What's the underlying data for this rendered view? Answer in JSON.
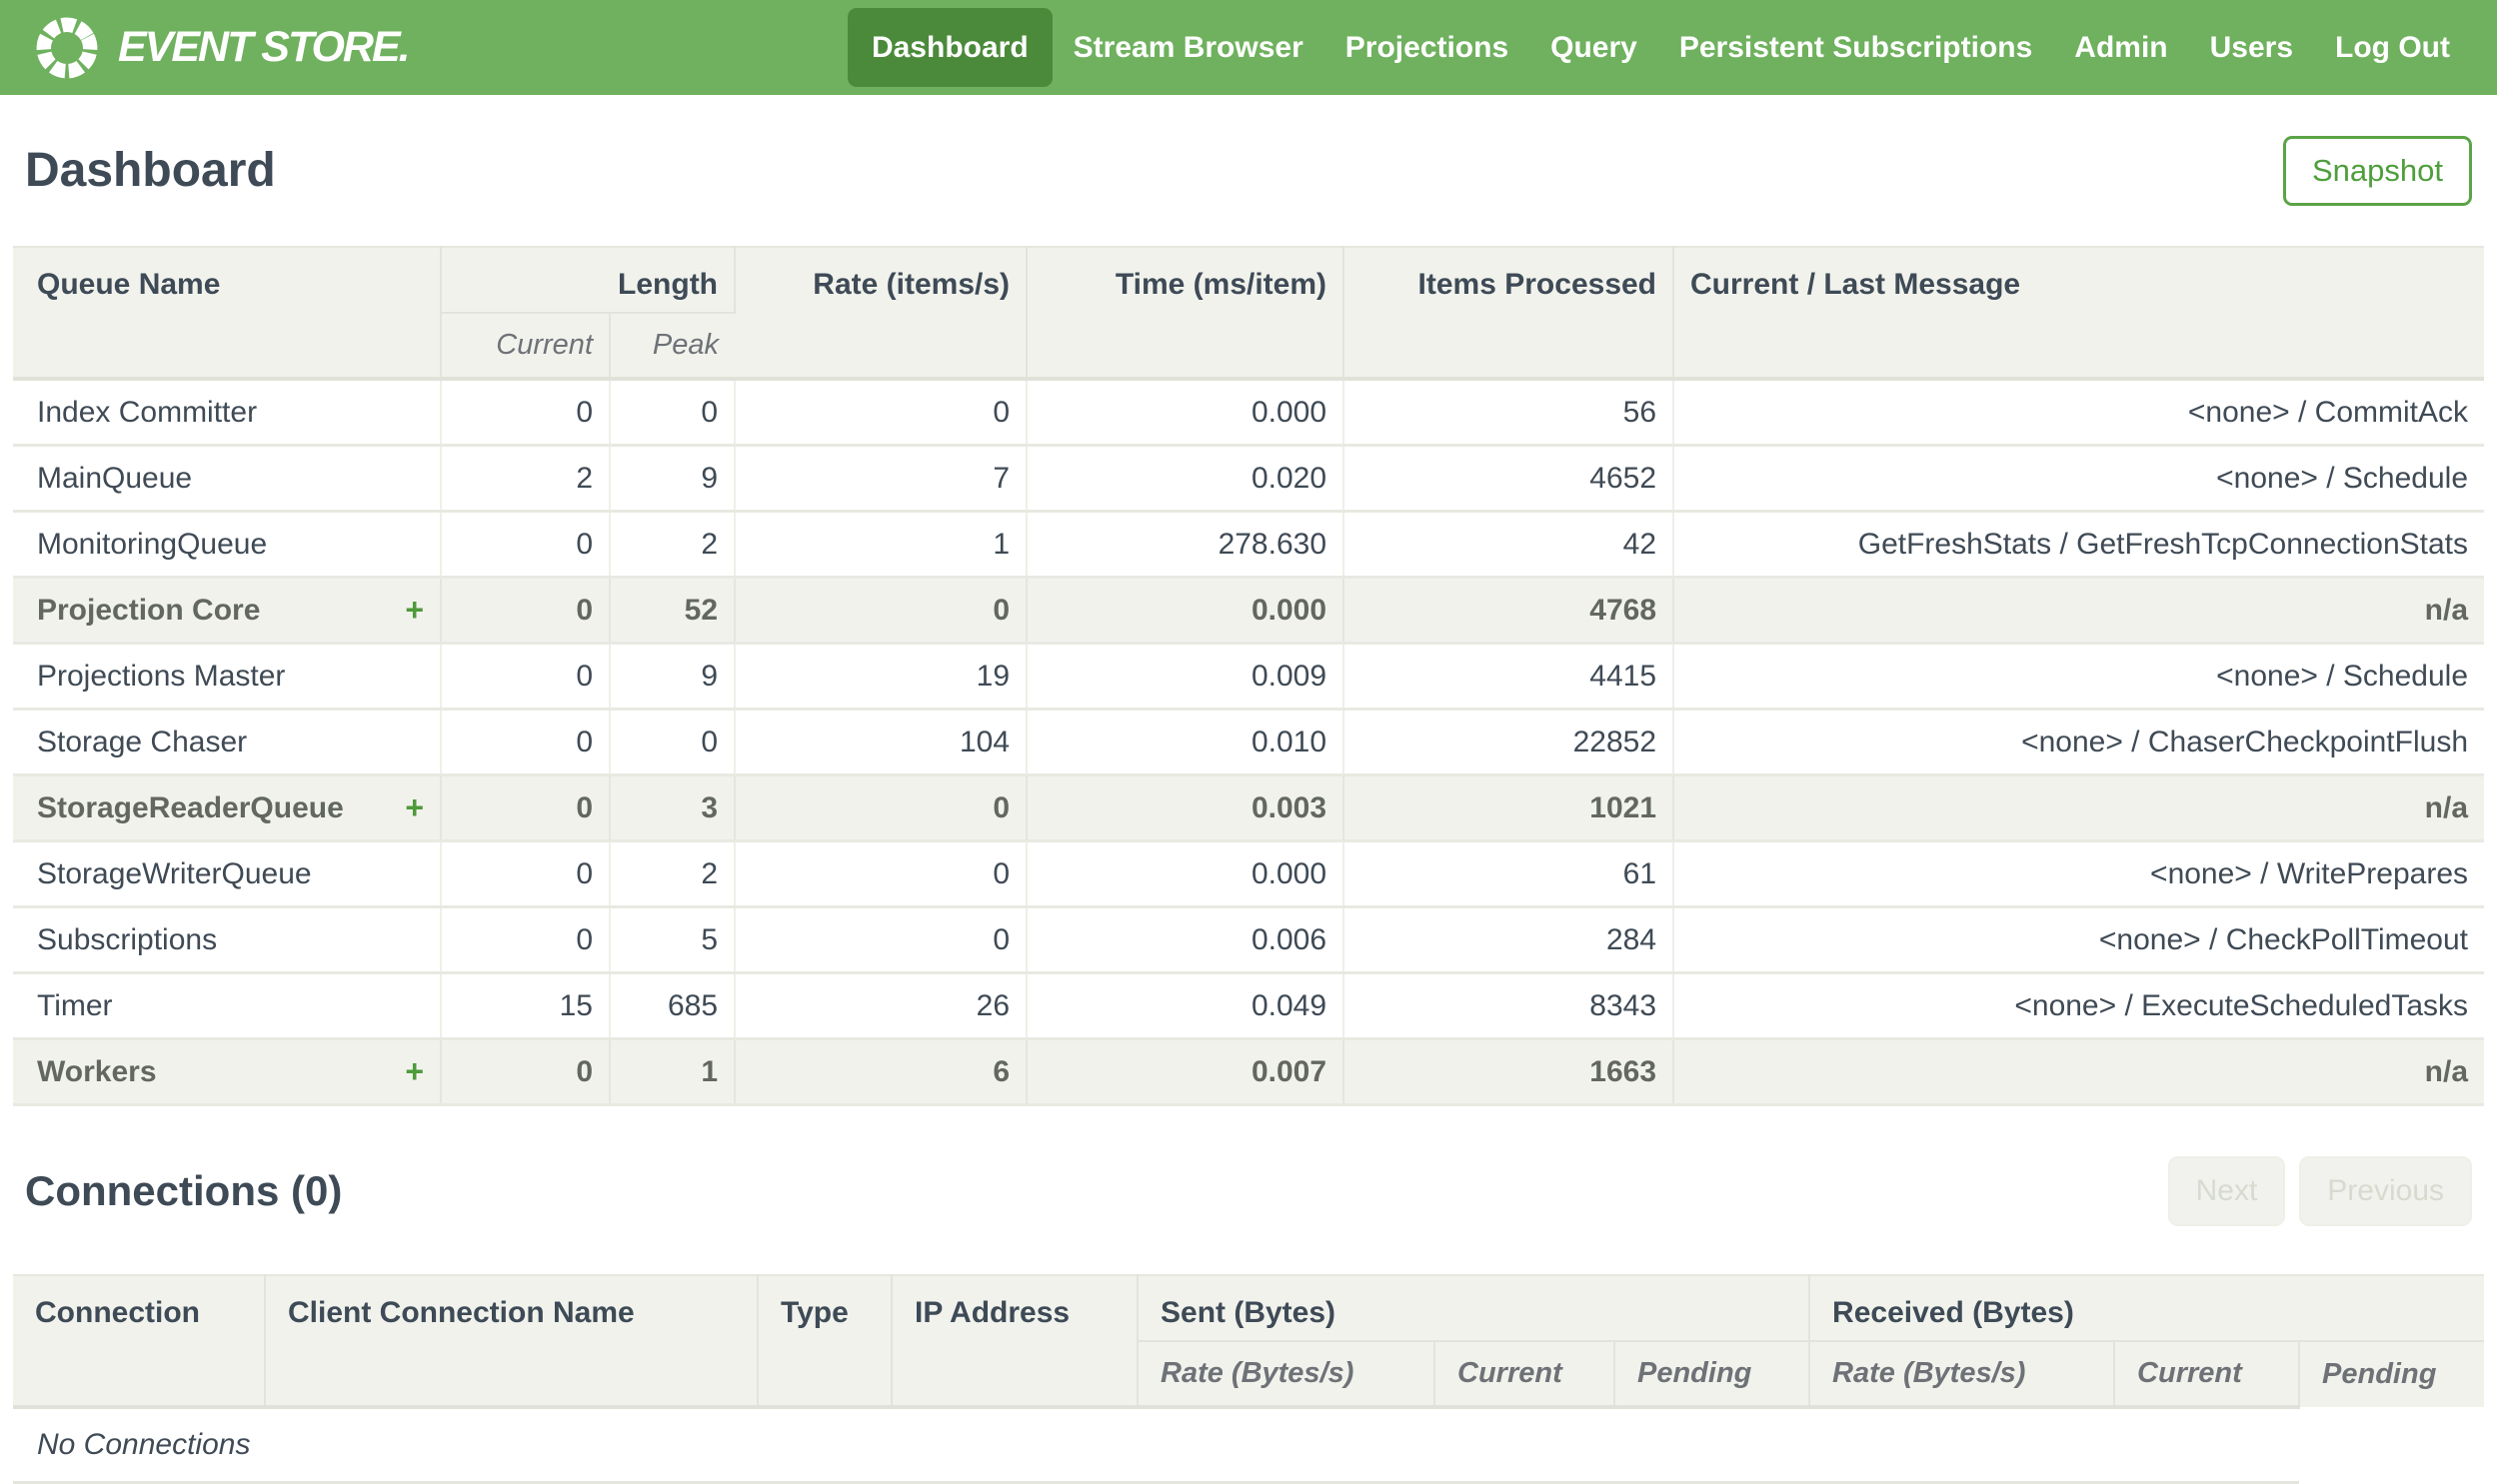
{
  "nav": {
    "brand": "EVENT STORE.",
    "items": [
      {
        "label": "Dashboard",
        "active": true
      },
      {
        "label": "Stream Browser"
      },
      {
        "label": "Projections"
      },
      {
        "label": "Query"
      },
      {
        "label": "Persistent Subscriptions"
      },
      {
        "label": "Admin"
      },
      {
        "label": "Users"
      },
      {
        "label": "Log Out"
      }
    ]
  },
  "page": {
    "title": "Dashboard",
    "snapshot_button": "Snapshot"
  },
  "queues": {
    "headers": {
      "queue_name": "Queue Name",
      "length": "Length",
      "current": "Current",
      "peak": "Peak",
      "rate": "Rate (items/s)",
      "time": "Time (ms/item)",
      "items_processed": "Items Processed",
      "message": "Current / Last Message"
    },
    "expand_glyph": "+",
    "rows": [
      {
        "name": "Index Committer",
        "current": "0",
        "peak": "0",
        "rate": "0",
        "time": "0.000",
        "items": "56",
        "message": "<none> / CommitAck"
      },
      {
        "name": "MainQueue",
        "current": "2",
        "peak": "9",
        "rate": "7",
        "time": "0.020",
        "items": "4652",
        "message": "<none> / Schedule"
      },
      {
        "name": "MonitoringQueue",
        "current": "0",
        "peak": "2",
        "rate": "1",
        "time": "278.630",
        "items": "42",
        "message": "GetFreshStats / GetFreshTcpConnectionStats"
      },
      {
        "name": "Projection Core",
        "group": true,
        "expandable": true,
        "current": "0",
        "peak": "52",
        "rate": "0",
        "time": "0.000",
        "items": "4768",
        "message": "n/a"
      },
      {
        "name": "Projections Master",
        "current": "0",
        "peak": "9",
        "rate": "19",
        "time": "0.009",
        "items": "4415",
        "message": "<none> / Schedule"
      },
      {
        "name": "Storage Chaser",
        "current": "0",
        "peak": "0",
        "rate": "104",
        "time": "0.010",
        "items": "22852",
        "message": "<none> / ChaserCheckpointFlush"
      },
      {
        "name": "StorageReaderQueue",
        "group": true,
        "expandable": true,
        "current": "0",
        "peak": "3",
        "rate": "0",
        "time": "0.003",
        "items": "1021",
        "message": "n/a"
      },
      {
        "name": "StorageWriterQueue",
        "current": "0",
        "peak": "2",
        "rate": "0",
        "time": "0.000",
        "items": "61",
        "message": "<none> / WritePrepares"
      },
      {
        "name": "Subscriptions",
        "current": "0",
        "peak": "5",
        "rate": "0",
        "time": "0.006",
        "items": "284",
        "message": "<none> / CheckPollTimeout"
      },
      {
        "name": "Timer",
        "current": "15",
        "peak": "685",
        "rate": "26",
        "time": "0.049",
        "items": "8343",
        "message": "<none> / ExecuteScheduledTasks"
      },
      {
        "name": "Workers",
        "group": true,
        "expandable": true,
        "current": "0",
        "peak": "1",
        "rate": "6",
        "time": "0.007",
        "items": "1663",
        "message": "n/a"
      }
    ]
  },
  "connections": {
    "title": "Connections (0)",
    "next_button": "Next",
    "previous_button": "Previous",
    "headers": {
      "connection": "Connection",
      "client_connection_name": "Client Connection Name",
      "type": "Type",
      "ip_address": "IP Address",
      "sent": {
        "label": "Sent (Bytes)",
        "rate": "Rate (Bytes/s)",
        "current": "Current",
        "pending": "Pending"
      },
      "received": {
        "label": "Received (Bytes)",
        "rate": "Rate (Bytes/s)",
        "current": "Current",
        "pending": "Pending"
      }
    },
    "empty_text": "No Connections"
  },
  "colors": {
    "nav_green": "#6fb15e",
    "active_tab_green": "#4b8a3a",
    "snapshot_green": "#5ba447",
    "header_bg": "#f1f2ec",
    "text_dark": "#3e4a56",
    "expand_green": "#4e9a3a"
  }
}
